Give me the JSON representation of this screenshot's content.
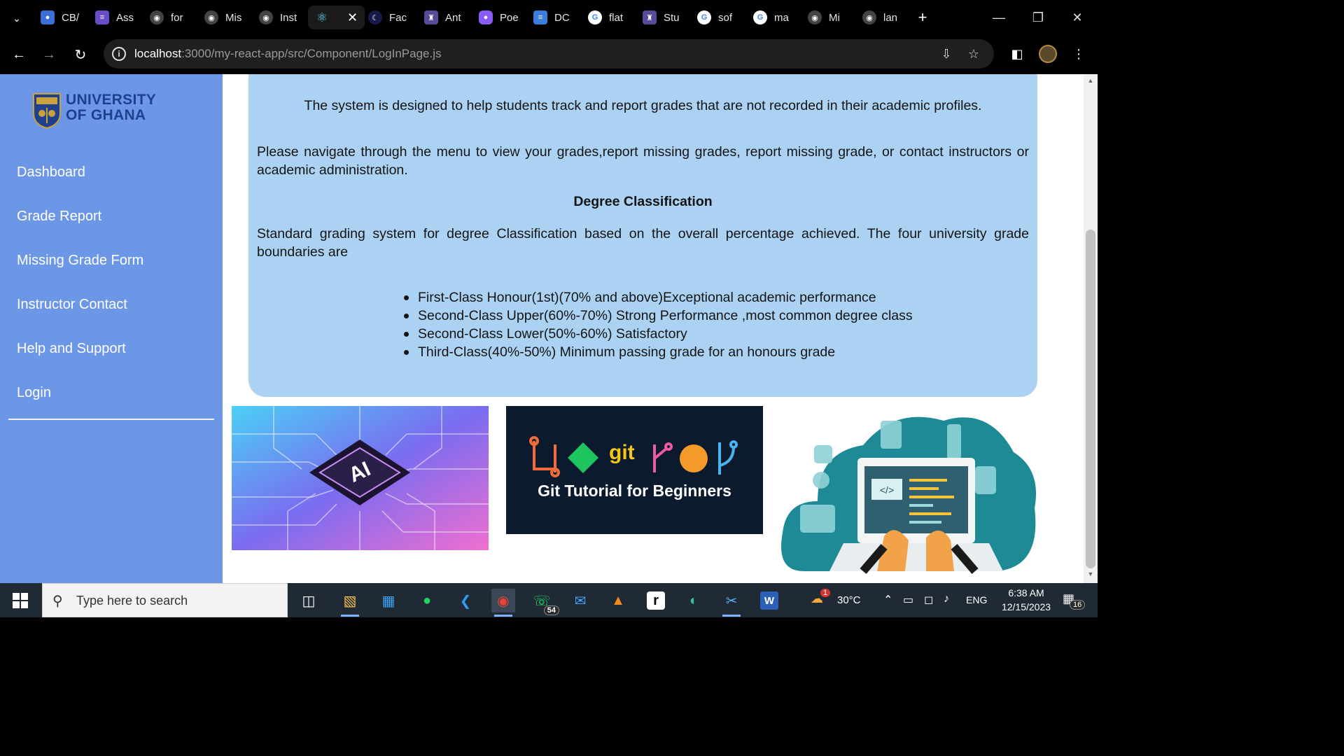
{
  "browser": {
    "tabs": [
      {
        "title": "CB/",
        "icon": "profile-icon",
        "color": "#3b6fd6"
      },
      {
        "title": "Ass",
        "icon": "list-icon",
        "color": "#6a4cc9"
      },
      {
        "title": "for",
        "icon": "globe-icon",
        "color": "#6b6b6b"
      },
      {
        "title": "Mis",
        "icon": "globe-icon",
        "color": "#6b6b6b"
      },
      {
        "title": "Inst",
        "icon": "globe-icon",
        "color": "#6b6b6b"
      },
      {
        "title": "",
        "icon": "react-icon",
        "color": "#61dafb",
        "active": true
      },
      {
        "title": "Fac",
        "icon": "moon-icon",
        "color": "#3a3aa0"
      },
      {
        "title": "Ant",
        "icon": "crest-icon",
        "color": "#5a4a9a"
      },
      {
        "title": "Poe",
        "icon": "chat-icon",
        "color": "#8a5cf5"
      },
      {
        "title": "DC",
        "icon": "doc-icon",
        "color": "#3b7ddd"
      },
      {
        "title": "flat",
        "icon": "google-icon",
        "color": "#ffffff"
      },
      {
        "title": "Stu",
        "icon": "crest-icon",
        "color": "#5a4a9a"
      },
      {
        "title": "sof",
        "icon": "google-icon",
        "color": "#ffffff"
      },
      {
        "title": "ma",
        "icon": "google-icon",
        "color": "#ffffff"
      },
      {
        "title": "Mi",
        "icon": "globe-icon",
        "color": "#6b6b6b"
      },
      {
        "title": "lan",
        "icon": "globe-icon",
        "color": "#6b6b6b"
      }
    ],
    "url_host": "localhost",
    "url_path": ":3000/my-react-app/src/Component/LogInPage.js"
  },
  "sidebar": {
    "logo_line1": "UNIVERSITY",
    "logo_line2": "OF GHANA",
    "items": [
      {
        "label": "Dashboard"
      },
      {
        "label": "Grade Report"
      },
      {
        "label": "Missing Grade Form"
      },
      {
        "label": "Instructor Contact"
      },
      {
        "label": "Help and Support"
      },
      {
        "label": "Login"
      }
    ]
  },
  "main": {
    "intro": "The system is designed to help students track and report grades that are not recorded in their academic profiles.",
    "navinfo": "Please navigate through the menu to view your grades,report missing grades, report missing grade, or contact instructors or academic administration.",
    "heading": "Degree Classification",
    "standard": "Standard grading system for degree Classification based on the overall percentage achieved. The four university grade boundaries are",
    "grades": [
      "First-Class Honour(1st)(70% and above)Exceptional academic performance",
      "Second-Class Upper(60%-70%) Strong Performance ,most common degree class",
      "Second-Class Lower(50%-60%) Satisfactory",
      "Third-Class(40%-50%) Minimum passing grade for an honours grade"
    ],
    "images": {
      "ai_text": "AI",
      "git_word": "git",
      "git_title": "Git Tutorial for Beginners",
      "code_tag": "</>"
    }
  },
  "taskbar": {
    "search_placeholder": "Type here to search",
    "whatsapp_badge": "54",
    "weather_badge": "1",
    "temperature": "30°C",
    "language": "ENG",
    "time": "6:38 AM",
    "date": "12/15/2023",
    "notification_count": "16"
  },
  "colors": {
    "sidebar": "#6c97e7",
    "card": "#abd2f2",
    "logo_text": "#1f3f8f",
    "git_bg": "#0c1a2e",
    "cloud": "#1e8a96"
  }
}
